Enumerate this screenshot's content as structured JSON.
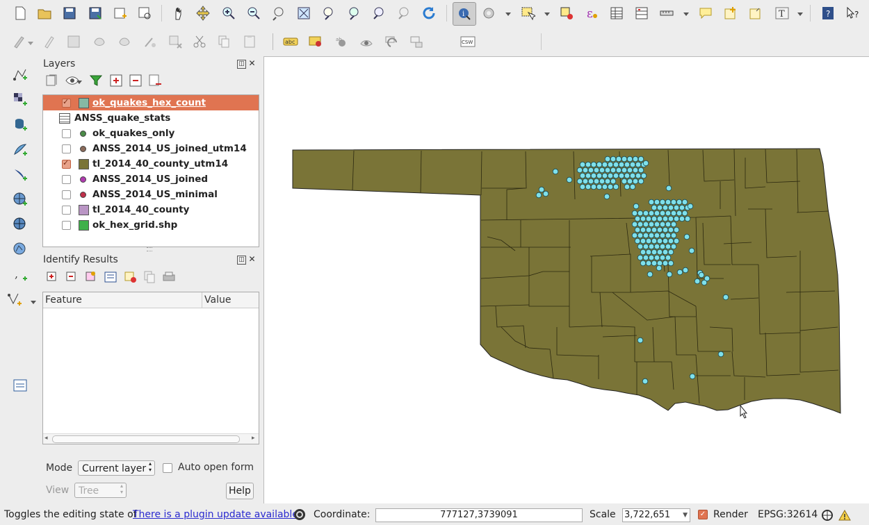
{
  "layers_panel": {
    "title": "Layers",
    "layers": [
      {
        "name": "ok_quakes_hex_count",
        "checkbox": "checked",
        "symbol": "swatch",
        "color": "#86b9a4",
        "selected": true
      },
      {
        "name": "ANSS_quake_stats",
        "checkbox": "none",
        "symbol": "table",
        "color": "",
        "selected": false
      },
      {
        "name": "ok_quakes_only",
        "checkbox": "unchecked",
        "symbol": "dot",
        "color": "#4b8b48",
        "selected": false
      },
      {
        "name": "ANSS_2014_US_joined_utm14",
        "checkbox": "unchecked",
        "symbol": "dot",
        "color": "#8a6a5a",
        "selected": false
      },
      {
        "name": "tl_2014_40_county_utm14",
        "checkbox": "checked",
        "symbol": "swatch",
        "color": "#7a7437",
        "selected": false
      },
      {
        "name": "ANSS_2014_US_joined",
        "checkbox": "unchecked",
        "symbol": "dot",
        "color": "#b03bb0",
        "selected": false
      },
      {
        "name": "ANSS_2014_US_minimal",
        "checkbox": "unchecked",
        "symbol": "dot",
        "color": "#c0304a",
        "selected": false
      },
      {
        "name": "tl_2014_40_county",
        "checkbox": "unchecked",
        "symbol": "swatch",
        "color": "#b995c4",
        "selected": false
      },
      {
        "name": "ok_hex_grid.shp",
        "checkbox": "unchecked",
        "symbol": "swatch",
        "color": "#3fb04a",
        "selected": false
      }
    ]
  },
  "identify_panel": {
    "title": "Identify Results",
    "col_feature": "Feature",
    "col_value": "Value",
    "mode_label": "Mode",
    "mode_value": "Current layer",
    "auto_open_label": "Auto open form",
    "view_label": "View",
    "view_value": "Tree",
    "help_label": "Help"
  },
  "toolbar": {
    "label_csw": "CSW",
    "label_abc": "abc",
    "more": "»"
  },
  "map": {
    "state_fill": "#7a7437",
    "point_fill": "#7fe0ea"
  },
  "statusbar": {
    "message": "Toggles the editing state of",
    "plugin_link": "There is a plugin update available",
    "coord_label": "Coordinate:",
    "coord_value": "777127,3739091",
    "scale_label": "Scale",
    "scale_value": "3,722,651",
    "render_label": "Render",
    "crs_label": "EPSG:32614"
  }
}
